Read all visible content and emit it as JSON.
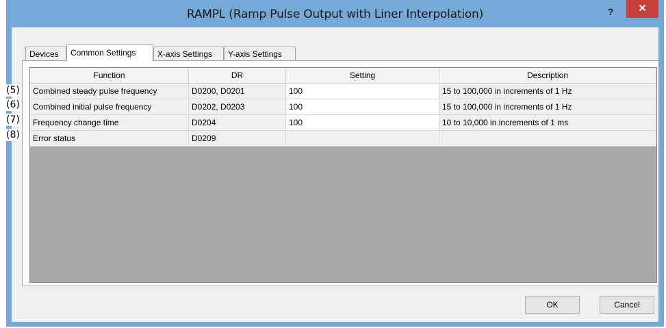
{
  "window": {
    "title": "RAMPL (Ramp Pulse Output with Liner Interpolation)",
    "help_label": "?",
    "close_label": "✕"
  },
  "tabs": [
    {
      "label": "Devices",
      "active": false
    },
    {
      "label": "Common Settings",
      "active": true
    },
    {
      "label": "X-axis Settings",
      "active": false
    },
    {
      "label": "Y-axis Settings",
      "active": false
    }
  ],
  "table": {
    "headers": [
      "Function",
      "DR",
      "Setting",
      "Description"
    ],
    "rows": [
      {
        "callout": "(5)",
        "function": "Combined steady pulse frequency",
        "dr": "D0200, D0201",
        "setting": "100",
        "description": "15 to 100,000 in increments of 1 Hz"
      },
      {
        "callout": "(6)",
        "function": "Combined initial pulse frequency",
        "dr": "D0202, D0203",
        "setting": "100",
        "description": "15 to 100,000 in increments of 1 Hz"
      },
      {
        "callout": "(7)",
        "function": "Frequency change time",
        "dr": "D0204",
        "setting": "100",
        "description": "10 to 10,000 in increments of 1 ms"
      },
      {
        "callout": "(8)",
        "function": "Error status",
        "dr": "D0209",
        "setting": "",
        "description": ""
      }
    ]
  },
  "buttons": {
    "ok": "OK",
    "cancel": "Cancel"
  },
  "colors": {
    "titlebar": "#74a9d8",
    "close": "#c7413a",
    "grid_background": "#a9a9a9"
  }
}
